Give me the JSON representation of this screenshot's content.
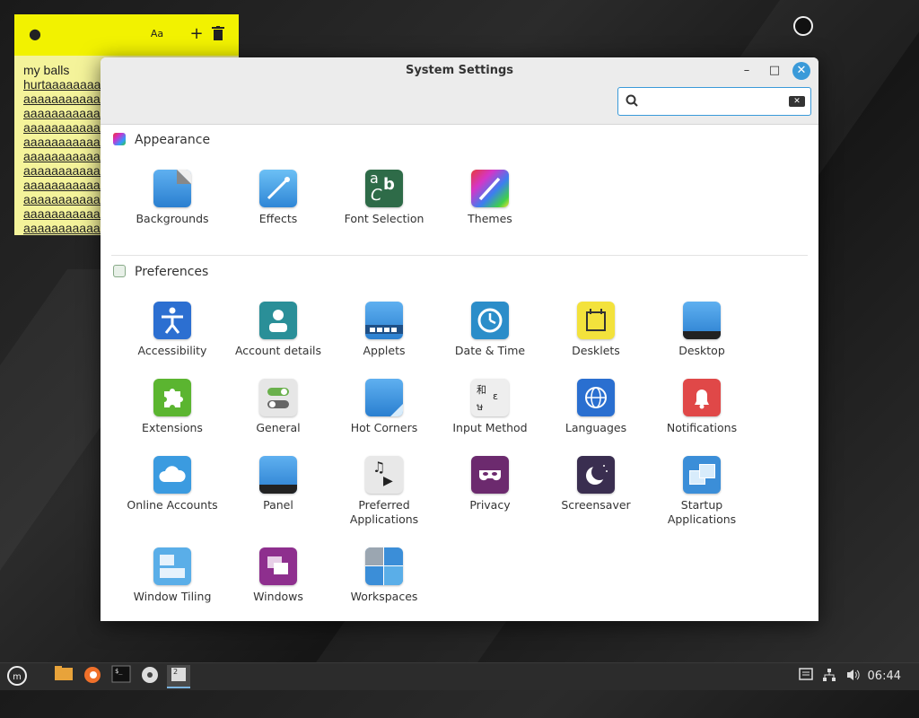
{
  "note": {
    "lines": [
      "my balls",
      "hurtaaaaaaaaa",
      "aaaaaaaaaaaa",
      "aaaaaaaaaaaa",
      "aaaaaaaaaaaa",
      "aaaaaaaaaaaa",
      "aaaaaaaaaaaa",
      "aaaaaaaaaaaa",
      "aaaaaaaaaaaa",
      "aaaaaaaaaaaa",
      "aaaaaaaaaaaa",
      "aaaaaaaaaaaa"
    ]
  },
  "window": {
    "title": "System Settings",
    "search_value": ""
  },
  "sections": {
    "appearance": {
      "title": "Appearance",
      "items": [
        "Backgrounds",
        "Effects",
        "Font Selection",
        "Themes"
      ]
    },
    "preferences": {
      "title": "Preferences",
      "items": [
        "Accessibility",
        "Account details",
        "Applets",
        "Date & Time",
        "Desklets",
        "Desktop",
        "Extensions",
        "General",
        "Hot Corners",
        "Input Method",
        "Languages",
        "Notifications",
        "Online Accounts",
        "Panel",
        "Preferred Applications",
        "Privacy",
        "Screensaver",
        "Startup Applications",
        "Window Tiling",
        "Windows",
        "Workspaces"
      ]
    }
  },
  "taskbar": {
    "clock": "06:44"
  },
  "colors": {
    "accent": "#3a9ad9",
    "note_bar": "#f2f200"
  },
  "icons": [
    "droplet-icon",
    "text-size-icon",
    "plus-icon",
    "trash-icon",
    "search-icon",
    "clear-icon",
    "minimize-icon",
    "maximize-icon",
    "close-icon",
    "menu-icon",
    "files-icon",
    "firefox-icon",
    "terminal-icon",
    "disc-icon",
    "notes-icon",
    "notification-icon",
    "network-icon",
    "volume-icon"
  ]
}
